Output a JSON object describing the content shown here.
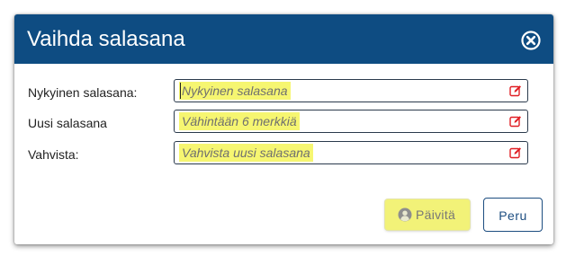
{
  "dialog": {
    "title": "Vaihda salasana",
    "close_icon": "close-circle-icon"
  },
  "form": {
    "fields": [
      {
        "label": "Nykyinen salasana:",
        "value": "",
        "placeholder": "Nykyinen salasana",
        "icon": "edit-icon",
        "focused": true
      },
      {
        "label": "Uusi salasana",
        "value": "",
        "placeholder": "Vähintään 6 merkkiä",
        "icon": "edit-icon",
        "focused": false
      },
      {
        "label": "Vahvista:",
        "value": "",
        "placeholder": "Vahvista uusi salasana",
        "icon": "edit-icon",
        "focused": false
      }
    ]
  },
  "buttons": {
    "update_label": "Päivitä",
    "update_icon": "user-icon",
    "cancel_label": "Peru"
  },
  "colors": {
    "header_bg": "#0e4c82",
    "highlight": "#f6f671",
    "edit_icon": "#e01e24",
    "cancel_border": "#1c4d80"
  }
}
